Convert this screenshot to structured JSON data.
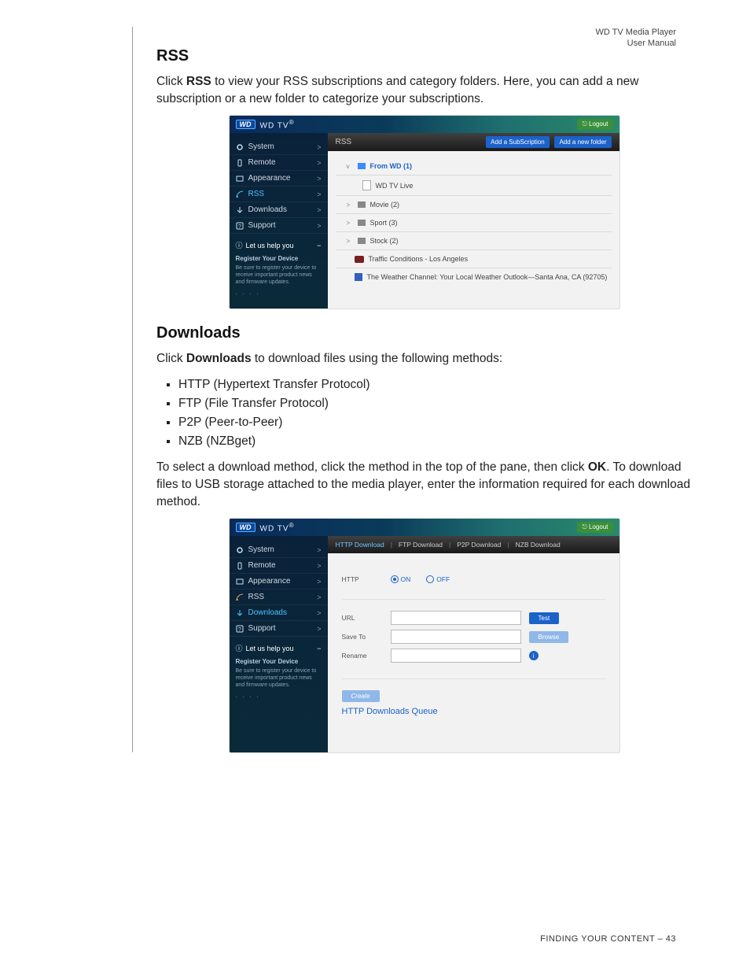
{
  "header": {
    "line1": "WD TV Media Player",
    "line2": "User Manual"
  },
  "rss": {
    "heading": "RSS",
    "para_before_bold": "Click ",
    "para_bold": "RSS",
    "para_after_bold": " to view your RSS subscriptions and category folders. Here, you can add a new subscription or a new folder to categorize your subscriptions."
  },
  "downloads": {
    "heading": "Downloads",
    "intro_before_bold": "Click ",
    "intro_bold": "Downloads",
    "intro_after_bold": " to download files using the following methods:",
    "bullets": {
      "b1": "HTTP (Hypertext Transfer Protocol)",
      "b2": "FTP (File Transfer Protocol)",
      "b3": "P2P (Peer-to-Peer)",
      "b4": "NZB (NZBget)"
    },
    "para2_a": "To select a download method, click the method in the top of the pane, then click ",
    "para2_bold": "OK",
    "para2_b": ". To download files to USB storage attached to the media player, enter the information required for each download method."
  },
  "shot_common": {
    "brand": "WD TV",
    "brand_mark": "WD",
    "brand_sup": "®",
    "logout": "Logout",
    "menu": {
      "system": "System",
      "remote": "Remote",
      "appearance": "Appearance",
      "rss": "RSS",
      "downloads": "Downloads",
      "support": "Support"
    },
    "chev": ">",
    "help_title": "Let us help you",
    "help_reg_title": "Register Your Device",
    "help_reg_text": "Be sure to register your device to receive important product news and firmware updates.",
    "dots": "· · · ·"
  },
  "shot1": {
    "tab_title": "RSS",
    "btn_add_sub": "Add a SubScription",
    "btn_add_folder": "Add a new folder",
    "rows": {
      "r1_tree": "v",
      "r1_label": "From WD (1)",
      "r1_child_label": "WD TV Live",
      "r2_tree": ">",
      "r2_label": "Movie (2)",
      "r3_tree": ">",
      "r3_label": "Sport (3)",
      "r4_tree": ">",
      "r4_label": "Stock (2)",
      "r5_label": "Traffic Conditions - Los Angeles",
      "r6_label": "The Weather Channel: Your Local Weather Outlook—Santa Ana, CA (92705)"
    }
  },
  "shot2": {
    "tabs": {
      "http": "HTTP Download",
      "ftp": "FTP Download",
      "p2p": "P2P Download",
      "nzb": "NZB Download",
      "sep": "|"
    },
    "form": {
      "http_label": "HTTP",
      "on": "ON",
      "off": "OFF",
      "url": "URL",
      "saveto": "Save To",
      "rename": "Rename",
      "test": "Test",
      "browse": "Browse",
      "create": "Create",
      "info": "i"
    },
    "queue_title": "HTTP Downloads Queue"
  },
  "footer": {
    "section": "FINDING YOUR CONTENT",
    "dash": " – ",
    "page": "43"
  }
}
